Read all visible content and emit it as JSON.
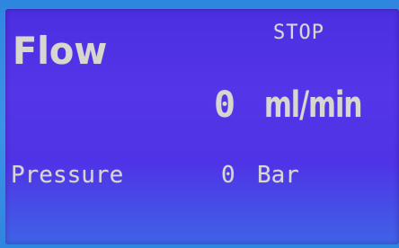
{
  "display": {
    "flow_label": "Flow",
    "status": "STOP",
    "flow_value": "0",
    "flow_unit": "ml/min",
    "pressure_label": "Pressure",
    "pressure_value": "0",
    "pressure_unit": "Bar"
  },
  "colors": {
    "screen_background": "#4f33e6",
    "text": "#d9d6cf",
    "bezel": "#3a8fd8"
  }
}
